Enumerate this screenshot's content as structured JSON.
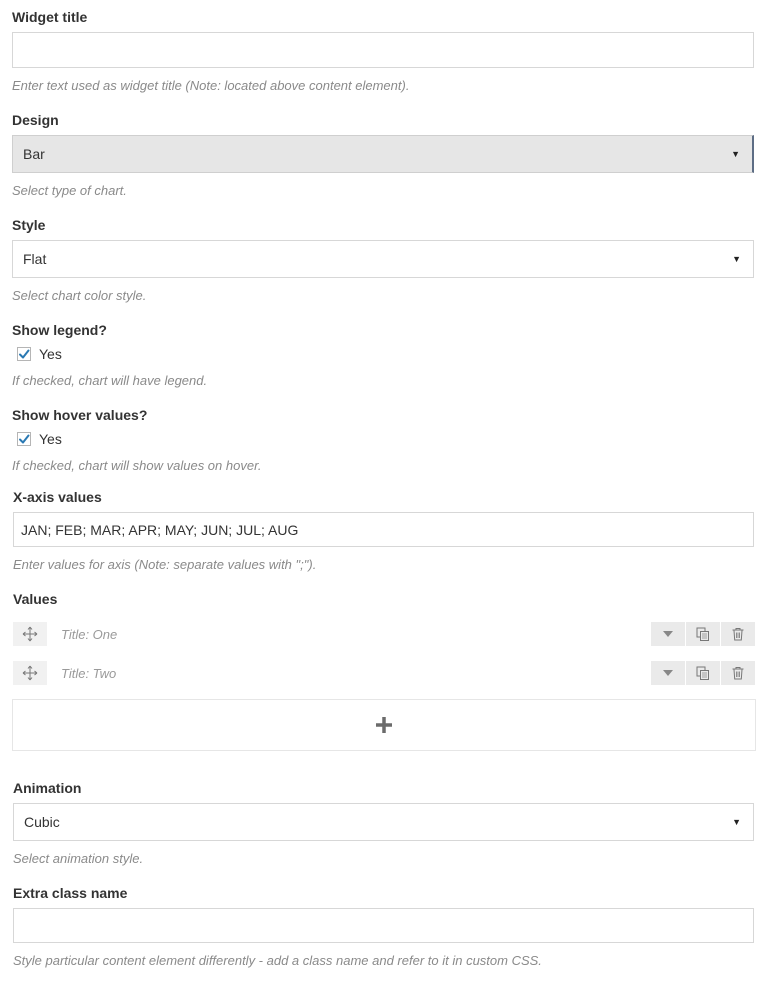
{
  "widget_title": {
    "label": "Widget title",
    "value": "",
    "help": "Enter text used as widget title (Note: located above content element)."
  },
  "design": {
    "label": "Design",
    "selected": "Bar",
    "help": "Select type of chart."
  },
  "style": {
    "label": "Style",
    "selected": "Flat",
    "help": "Select chart color style."
  },
  "show_legend": {
    "label": "Show legend?",
    "option": "Yes",
    "checked": true,
    "help": "If checked, chart will have legend."
  },
  "show_hover": {
    "label": "Show hover values?",
    "option": "Yes",
    "checked": true,
    "help": "If checked, chart will show values on hover."
  },
  "x_axis": {
    "label": "X-axis values",
    "value": "JAN; FEB; MAR; APR; MAY; JUN; JUL; AUG",
    "help": "Enter values for axis (Note: separate values with \";\")."
  },
  "values": {
    "label": "Values",
    "items": [
      {
        "title": "Title: One"
      },
      {
        "title": "Title: Two"
      }
    ]
  },
  "animation": {
    "label": "Animation",
    "selected": "Cubic",
    "help": "Select animation style."
  },
  "extra_class": {
    "label": "Extra class name",
    "value": "",
    "help": "Style particular content element differently - add a class name and refer to it in custom CSS."
  },
  "icons": {
    "caret": "caret-down-icon",
    "check": "checkmark-icon",
    "drag": "move-arrows-icon",
    "toggle": "triangle-down-icon",
    "clone": "copy-icon",
    "delete": "trash-icon",
    "add": "plus-icon"
  },
  "colors": {
    "check_blue": "#2a79b3",
    "help_gray": "#8a8a8a",
    "select_gray_bg": "#e6e6e6"
  }
}
